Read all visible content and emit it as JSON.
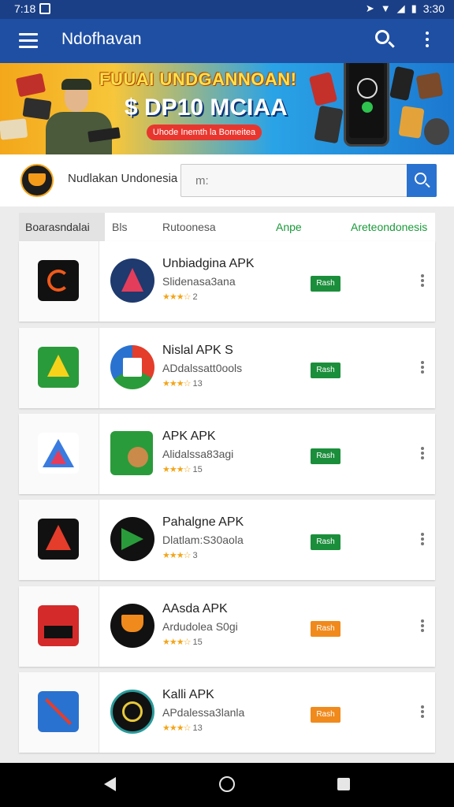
{
  "status_bar": {
    "left_text": "7:18",
    "time": "3:30"
  },
  "app_bar": {
    "title": "Ndofhavan"
  },
  "banner": {
    "headline": "FUUAI UNDGANNOAN!",
    "subheadline": "$ DP10 MCIAA",
    "pill": "Uhode Inemth la Bomeitea"
  },
  "brand": {
    "name": "Nudlakan Undonesia"
  },
  "search": {
    "value": "m:"
  },
  "tabs": [
    {
      "label": "Boarasndalai",
      "active": true
    },
    {
      "label": "Bls"
    },
    {
      "label": "Rutoonesa"
    },
    {
      "label": "Anpe",
      "green": true
    },
    {
      "label": "Areteondonesis",
      "green": true
    }
  ],
  "apps": [
    {
      "name": "Unbiadgina APK",
      "developer": "Slidenasa3ana",
      "stars": "★★★☆",
      "rating": "2",
      "button": "Rash",
      "button_color": "#1b8e3b"
    },
    {
      "name": "Nislal APK S",
      "developer": "ADdalssatt0ools",
      "stars": "★★★☆",
      "rating": "13",
      "button": "Rash",
      "button_color": "#1b8e3b"
    },
    {
      "name": "APK APK",
      "developer": "Alidalssa83agi",
      "stars": "★★★☆",
      "rating": "15",
      "button": "Rash",
      "button_color": "#1b8e3b"
    },
    {
      "name": "Pahalgne APK",
      "developer": "Dlatlam:S30aola",
      "stars": "★★★☆",
      "rating": "3",
      "button": "Rash",
      "button_color": "#1b8e3b"
    },
    {
      "name": "AAsda APK",
      "developer": "Ardudolea S0gi",
      "stars": "★★★☆",
      "rating": "15",
      "button": "Rash",
      "button_color": "#f08a1d"
    },
    {
      "name": "Kalli APK",
      "developer": "APdalessa3lanla",
      "stars": "★★★☆",
      "rating": "13",
      "button": "Rash",
      "button_color": "#f08a1d"
    }
  ],
  "icons": {
    "status_left": "image-icon",
    "status_right": [
      "navigation-icon",
      "wifi-icon",
      "signal-icon",
      "battery-icon"
    ],
    "app_bar": [
      "menu-icon",
      "search-icon",
      "overflow-menu-icon"
    ],
    "nav": [
      "back-icon",
      "home-icon",
      "recent-apps-icon"
    ]
  },
  "colors": {
    "app_bar": "#1f4fa3",
    "status_bar": "#1a3f86",
    "accent": "#2a72cf",
    "green": "#1b8e3b",
    "orange": "#f08a1d"
  }
}
